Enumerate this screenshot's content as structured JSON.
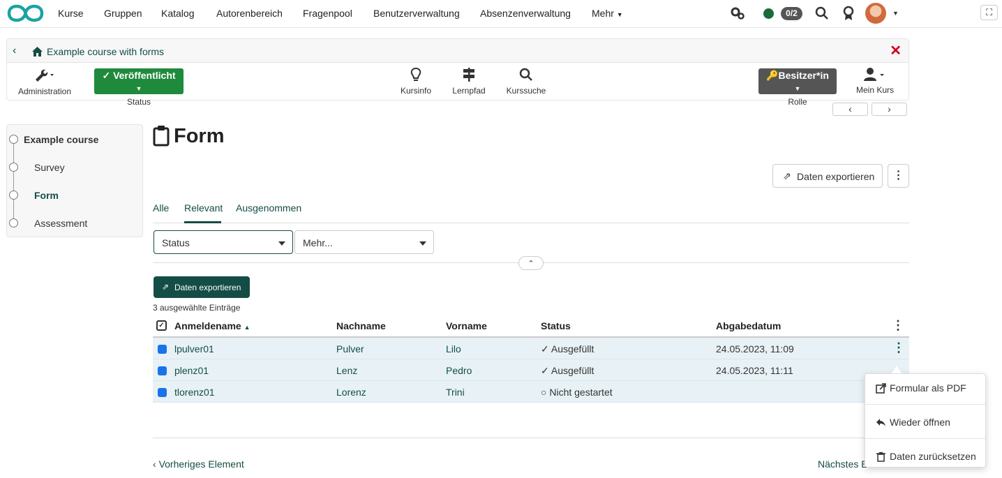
{
  "nav": {
    "items": [
      "Kurse",
      "Gruppen",
      "Katalog",
      "Autorenbereich",
      "Fragenpool",
      "Benutzerverwaltung",
      "Absenzenverwaltung",
      "Mehr"
    ],
    "counter": "0/2",
    "status_color": "#1a6b3a"
  },
  "course": {
    "title": "Example course with forms",
    "admin_label": "Administration",
    "status_badge": "Veröffentlicht",
    "status_label": "Status",
    "tools": [
      "Kursinfo",
      "Lernpfad",
      "Kurssuche"
    ],
    "role_badge": "Besitzer*in",
    "role_label": "Rolle",
    "mycourse_label": "Mein Kurs"
  },
  "sidebar": {
    "items": [
      {
        "label": "Example course"
      },
      {
        "label": "Survey"
      },
      {
        "label": "Form"
      },
      {
        "label": "Assessment"
      }
    ]
  },
  "main": {
    "title": "Form",
    "export_button": "Daten exportieren",
    "tabs": [
      "Alle",
      "Relevant",
      "Ausgenommen"
    ],
    "filter_status": "Status",
    "filter_more": "Mehr...",
    "export_primary": "Daten exportieren",
    "selected_count": "3 ausgewählte Einträge"
  },
  "table": {
    "headers": [
      "Anmeldename",
      "Nachname",
      "Vorname",
      "Status",
      "Abgabedatum"
    ],
    "rows": [
      {
        "login": "lpulver01",
        "last": "Pulver",
        "first": "Lilo",
        "status": "Ausgefüllt",
        "date": "24.05.2023, 11:09"
      },
      {
        "login": "plenz01",
        "last": "Lenz",
        "first": "Pedro",
        "status": "Ausgefüllt",
        "date": "24.05.2023, 11:11"
      },
      {
        "login": "tlorenz01",
        "last": "Lorenz",
        "first": "Trini",
        "status": "Nicht gestartet",
        "date": ""
      }
    ]
  },
  "menu": {
    "items": [
      "Formular als PDF",
      "Wieder öffnen",
      "Daten zurücksetzen"
    ]
  },
  "footer": {
    "prev": "Vorheriges Element",
    "next": "Nächstes E"
  },
  "colors": {
    "brand": "#134d46",
    "accent": "#1f8a3c",
    "close": "#d0021b"
  }
}
